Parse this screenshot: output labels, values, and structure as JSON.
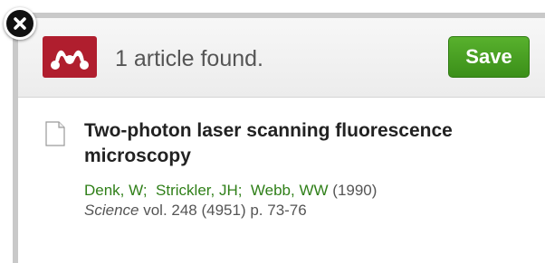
{
  "header": {
    "status_text": "1 article found.",
    "save_label": "Save"
  },
  "icons": {
    "close": "close-icon",
    "logo": "mendeley-logo-icon",
    "document": "document-icon"
  },
  "colors": {
    "brand_red": "#b01e2e",
    "save_green": "#3b8f19",
    "author_green": "#2f7f18",
    "close_black": "#111111"
  },
  "result": {
    "title": "Two-photon laser scanning fluorescence microscopy",
    "authors": [
      "Denk, W",
      "Strickler, JH",
      "Webb, WW"
    ],
    "year": "(1990)",
    "journal_name": "Science",
    "journal_details": " vol. 248 (4951) p. 73-76"
  }
}
